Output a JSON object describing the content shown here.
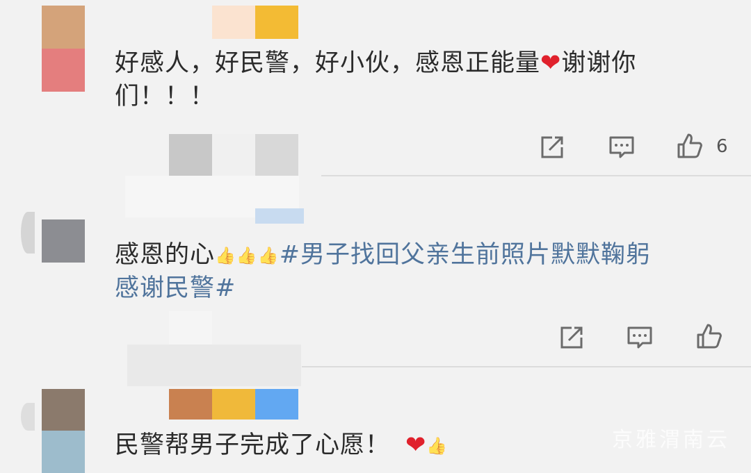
{
  "comments": [
    {
      "text": "好感人，好民警，好小伙，感恩正能量",
      "text_end": "谢谢你",
      "line2": "们！！！",
      "like_count": "6"
    },
    {
      "text": "感恩的心",
      "topic_line1": "#男子找回父亲生前照片默默鞠躬",
      "topic_line2": "感谢民警#"
    },
    {
      "text": "民警帮男子完成了心愿！"
    }
  ],
  "icons": {
    "share": "share-icon",
    "comment": "comment-icon",
    "like": "thumbs-up-icon",
    "heart": "heart-emoji",
    "thumbs": "thumbs-up-emoji"
  },
  "watermark": "京雅渭南云",
  "colors": {
    "background": "#f2f2f2",
    "topic": "#50749c",
    "heart": "#e0212c",
    "text": "#2b2b2b"
  }
}
